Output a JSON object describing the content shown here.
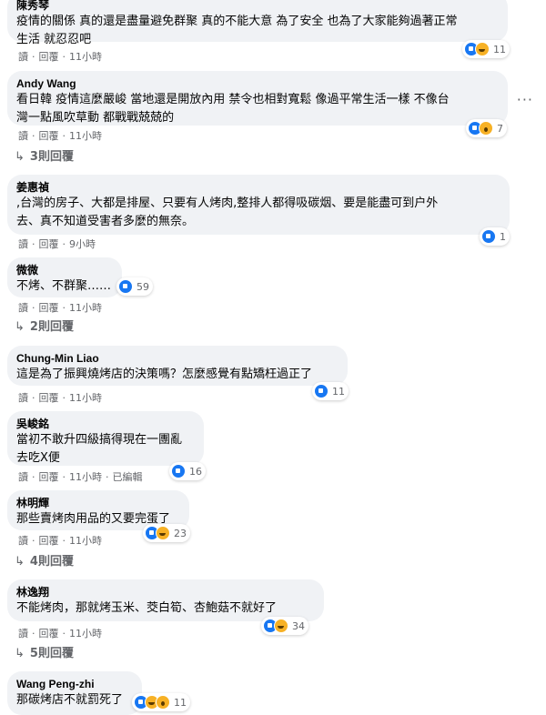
{
  "comments": [
    {
      "name": "陳秀琴",
      "lines": [
        "疫情的關係 真的還是盡量避免群聚 真的不能大意 為了安全 也為了大家能夠過著正常",
        "生活 就忍忍吧"
      ],
      "actions": [
        "讀",
        "回覆",
        "11小時"
      ],
      "reactions": [
        "like",
        "haha"
      ],
      "count": "11"
    },
    {
      "name": "Andy Wang",
      "lines": [
        "看日韓 疫情這麼嚴峻 當地還是開放內用 禁令也相對寬鬆 像過平常生活一樣 不像台",
        "灣一點風吹草動 都戰戰兢兢的"
      ],
      "actions": [
        "讀",
        "回覆",
        "11小時"
      ],
      "reactions": [
        "like",
        "wow"
      ],
      "count": "7",
      "replies": "3則回覆"
    },
    {
      "name": "姜惠禎",
      "lines": [
        ",台灣的房子、大都是排屋、只要有人烤肉,整排人都得吸碳烟、要是能盡可到户外",
        "去、真不知道受害者多麼的無奈。"
      ],
      "actions": [
        "讀",
        "回覆",
        "9小時"
      ],
      "reactions": [
        "like"
      ],
      "count": "1"
    },
    {
      "name": "微微",
      "lines": [
        "不烤、不群聚……"
      ],
      "actions": [
        "讀",
        "回覆",
        "11小時"
      ],
      "reactions": [
        "like"
      ],
      "count": "59",
      "replies": "2則回覆"
    },
    {
      "name": "Chung-Min Liao",
      "lines": [
        "這是為了振興燒烤店的決策嗎？怎麼感覺有點矯枉過正了"
      ],
      "actions": [
        "讀",
        "回覆",
        "11小時"
      ],
      "reactions": [
        "like"
      ],
      "count": "11"
    },
    {
      "name": "吳峻銘",
      "lines": [
        "當初不敢升四級搞得現在一團亂",
        "去吃X便"
      ],
      "actions": [
        "讀",
        "回覆",
        "11小時",
        "已編輯"
      ],
      "reactions": [
        "like"
      ],
      "count": "16"
    },
    {
      "name": "林明輝",
      "lines": [
        "那些賣烤肉用品的又要完蛋了"
      ],
      "actions": [
        "讀",
        "回覆",
        "11小時"
      ],
      "reactions": [
        "like",
        "haha"
      ],
      "count": "23",
      "replies": "4則回覆"
    },
    {
      "name": "林逸翔",
      "lines": [
        "不能烤肉，那就烤玉米、茭白筍、杏鮑菇不就好了"
      ],
      "actions": [
        "讀",
        "回覆",
        "11小時"
      ],
      "reactions": [
        "like",
        "haha"
      ],
      "count": "34",
      "replies": "5則回覆"
    },
    {
      "name": "Wang Peng-zhi",
      "lines": [
        "那碳烤店不就罰死了"
      ],
      "actions": [],
      "reactions": [
        "like",
        "haha",
        "wow"
      ],
      "count": "11"
    }
  ],
  "more_icon": "···"
}
